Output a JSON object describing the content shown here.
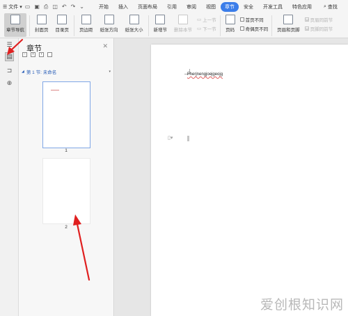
{
  "menubar": {
    "file_label": "文件",
    "tabs": [
      "开始",
      "插入",
      "页面布局",
      "引用",
      "审阅",
      "视图",
      "章节",
      "安全",
      "开发工具",
      "特色应用"
    ],
    "active_tab": "章节",
    "search_label": "查找"
  },
  "ribbon": {
    "chapter_nav": "章节导航",
    "cover_page": "封面页",
    "toc_page": "目录页",
    "margins": "页边距",
    "orientation": "纸张方向",
    "paper_size": "纸张大小",
    "new_section": "新增节",
    "delete_section": "删除本节",
    "prev_section": "上一节",
    "next_section": "下一节",
    "page_number": "页码",
    "first_page_diff": "首页不同",
    "odd_even_diff": "奇偶页不同",
    "header_footer": "页眉和页脚",
    "same_as_prev_header": "页眉同前节",
    "same_as_prev_footer": "页脚同前节"
  },
  "panel": {
    "title": "章节",
    "section_label": "第 1 节: 未命名",
    "pages": [
      "1",
      "2"
    ]
  },
  "document": {
    "text": "Fherjnengjoejgeojg"
  },
  "watermark": "爱创根知识网",
  "colors": {
    "accent": "#3b7de9",
    "arrow": "#e02020",
    "section_text": "#2a5fb8"
  }
}
